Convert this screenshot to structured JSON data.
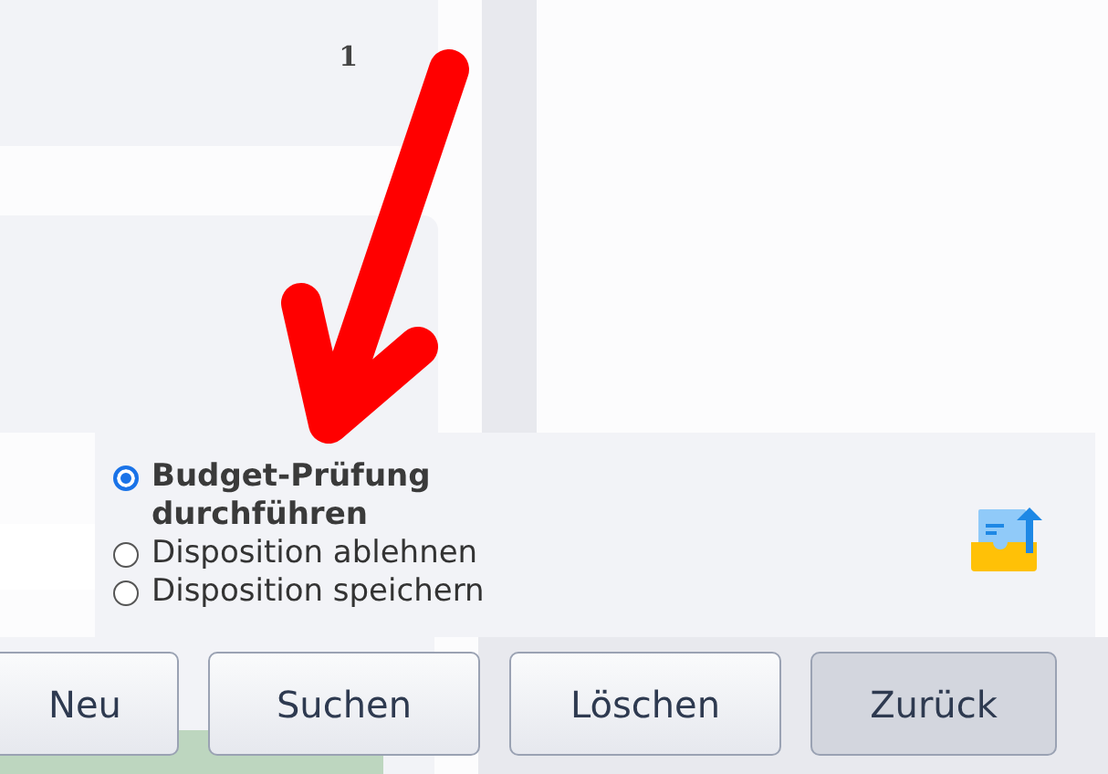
{
  "marker": "1",
  "options": [
    {
      "label": "Budget-Prüfung durchführen",
      "selected": true
    },
    {
      "label": "Disposition ablehnen",
      "selected": false
    },
    {
      "label": "Disposition speichern",
      "selected": false
    }
  ],
  "buttons": [
    {
      "label": "Neu",
      "selected": false
    },
    {
      "label": "Suchen",
      "selected": false
    },
    {
      "label": "Löschen",
      "selected": false
    },
    {
      "label": "Zurück",
      "selected": true
    }
  ]
}
